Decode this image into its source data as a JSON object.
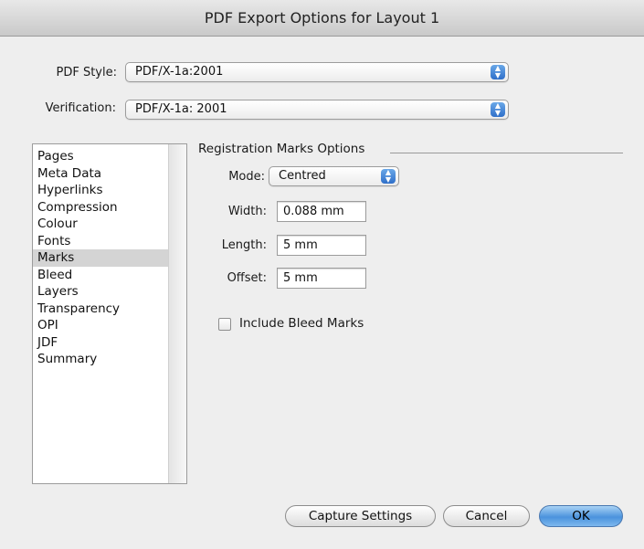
{
  "window": {
    "title": "PDF Export Options for Layout 1"
  },
  "pdf_style": {
    "label": "PDF Style:",
    "value": "PDF/X-1a:2001"
  },
  "verification": {
    "label": "Verification:",
    "value": "PDF/X-1a: 2001"
  },
  "sidebar": {
    "items": [
      {
        "label": "Pages"
      },
      {
        "label": "Meta Data"
      },
      {
        "label": "Hyperlinks"
      },
      {
        "label": "Compression"
      },
      {
        "label": "Colour"
      },
      {
        "label": "Fonts"
      },
      {
        "label": "Marks"
      },
      {
        "label": "Bleed"
      },
      {
        "label": "Layers"
      },
      {
        "label": "Transparency"
      },
      {
        "label": "OPI"
      },
      {
        "label": "JDF"
      },
      {
        "label": "Summary"
      }
    ],
    "selected": "Marks"
  },
  "registration": {
    "title": "Registration Marks Options",
    "mode": {
      "label": "Mode:",
      "value": "Centred"
    },
    "width": {
      "label": "Width:",
      "value": "0.088 mm"
    },
    "length": {
      "label": "Length:",
      "value": "5 mm"
    },
    "offset": {
      "label": "Offset:",
      "value": "5 mm"
    },
    "include_bleed": {
      "label": "Include Bleed Marks",
      "checked": false
    }
  },
  "buttons": {
    "capture": "Capture Settings",
    "cancel": "Cancel",
    "ok": "OK"
  },
  "colors": {
    "accent": "#4b93dd",
    "selection": "#d4d4d4",
    "background": "#eeeeee"
  }
}
